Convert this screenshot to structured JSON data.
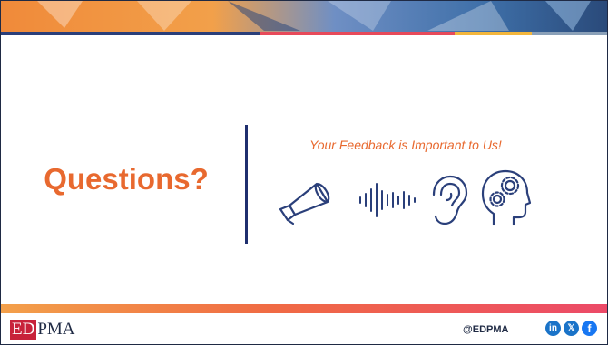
{
  "slide": {
    "title": "Questions?",
    "subtitle": "Your Feedback is Important to Us!",
    "icons": [
      "megaphone-icon",
      "sound-wave-icon",
      "ear-icon",
      "head-gears-icon"
    ]
  },
  "footer": {
    "logo_ed": "ED",
    "logo_pma": "PMA",
    "handle": "@EDPMA",
    "social": {
      "linkedin": "in",
      "x": "𝕏",
      "facebook": "f"
    }
  },
  "colors": {
    "accent_orange": "#e8692f",
    "navy": "#1f2f6e",
    "brand_red": "#c8223a",
    "social_blue": "#1a73c8"
  }
}
